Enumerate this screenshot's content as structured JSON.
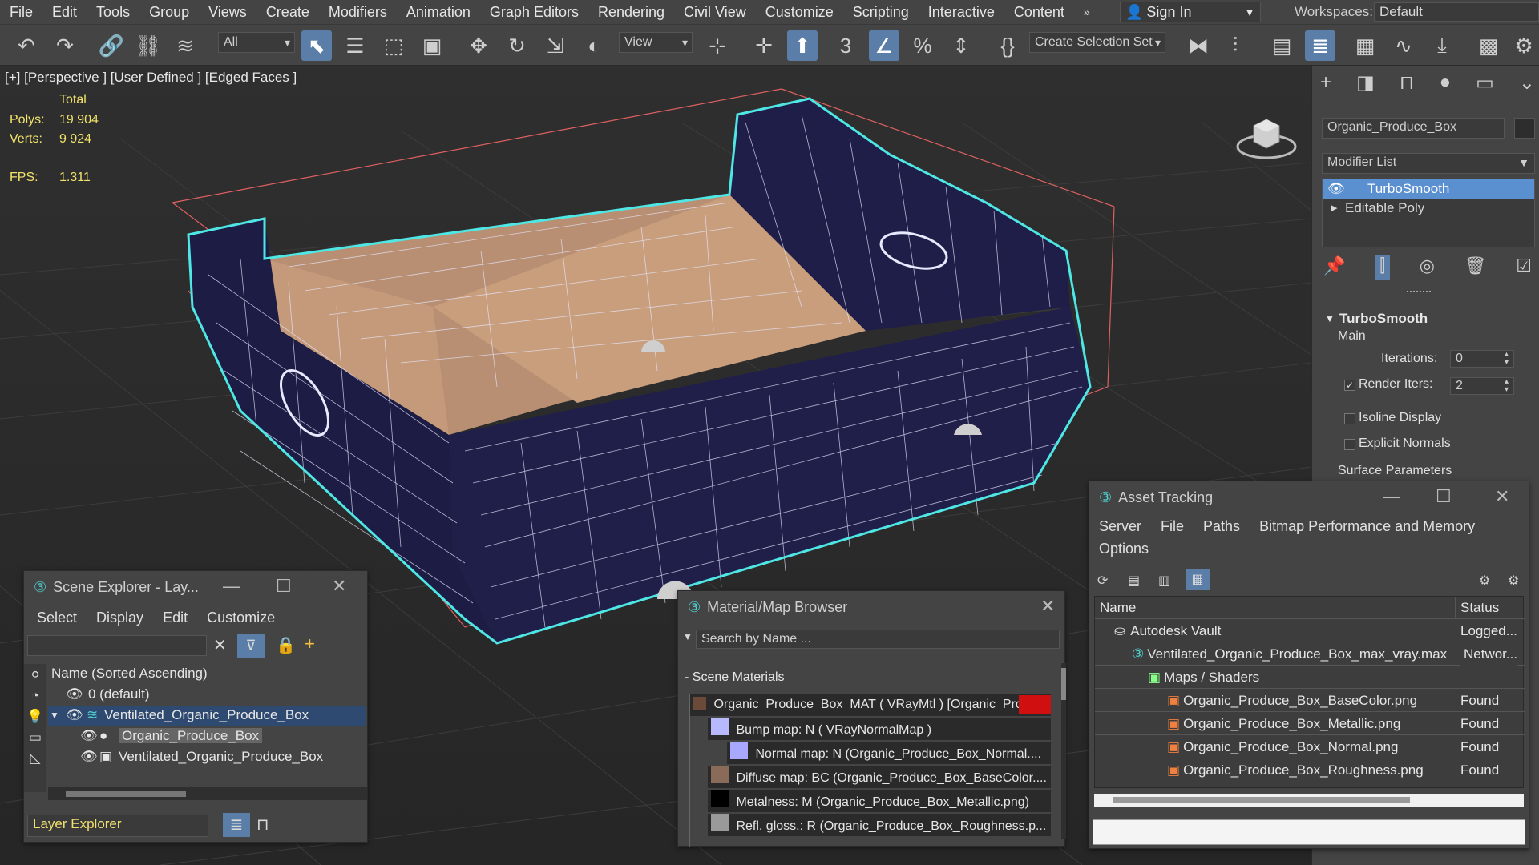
{
  "menubar": {
    "items": [
      "File",
      "Edit",
      "Tools",
      "Group",
      "Views",
      "Create",
      "Modifiers",
      "Animation",
      "Graph Editors",
      "Rendering",
      "Civil View",
      "Customize",
      "Scripting",
      "Interactive",
      "Content"
    ],
    "overflow": "»",
    "sign_in": "Sign In",
    "workspaces_label": "Workspaces:",
    "workspace_value": "Default"
  },
  "toolbar": {
    "filter_value": "All",
    "view_value": "View",
    "selection_set_value": "Create Selection Set",
    "icons": [
      "undo-icon",
      "redo-icon",
      "link-icon",
      "unlink-icon",
      "bind-spacewarp-icon",
      "select-icon",
      "select-by-name-icon",
      "rect-region-icon",
      "window-crossing-icon",
      "move-icon",
      "rotate-icon",
      "scale-icon",
      "place-icon",
      "pivot-icon",
      "snap-move-icon",
      "select-manipulate-icon",
      "snap-3d-icon",
      "angle-snap-icon",
      "percent-snap-icon",
      "spinner-snap-icon",
      "edit-named-sets-icon",
      "mirror-icon",
      "align-icon",
      "scene-explorer-icon",
      "layer-explorer-icon",
      "ribbon-icon",
      "curve-editor-icon",
      "schematic-icon",
      "material-editor-icon"
    ]
  },
  "viewport": {
    "label": "[+] [Perspective ] [User Defined ] [Edged Faces ]",
    "stats": {
      "total_label": "Total",
      "polys_label": "Polys:",
      "polys_value": "19 904",
      "verts_label": "Verts:",
      "verts_value": "9 924",
      "fps_label": "FPS:",
      "fps_value": "1.311"
    },
    "colors": {
      "wire": "#ffffff",
      "selection": "#4fe6e6",
      "crate_side": "#1e1d45",
      "crate_inner": "#c49a7a",
      "bbox": "#e06060"
    }
  },
  "command_panel": {
    "object_name": "Organic_Produce_Box",
    "modifier_list_label": "Modifier List",
    "stack": [
      {
        "name": "TurboSmooth",
        "selected": true
      },
      {
        "name": "Editable Poly",
        "selected": false
      }
    ],
    "rollout_title": "TurboSmooth",
    "group_main": "Main",
    "iterations_label": "Iterations:",
    "iterations_value": "0",
    "render_iters_label": "Render Iters:",
    "render_iters_value": "2",
    "isoline_label": "Isoline Display",
    "explicit_normals_label": "Explicit Normals",
    "surface_params_label": "Surface Parameters"
  },
  "scene_explorer": {
    "title": "Scene Explorer - Lay...",
    "menu": [
      "Select",
      "Display",
      "Edit",
      "Customize"
    ],
    "column_header": "Name (Sorted Ascending)",
    "rows": [
      {
        "name": "0 (default)",
        "indent": 0
      },
      {
        "name": "Ventilated_Organic_Produce_Box",
        "indent": 0,
        "selected": true
      },
      {
        "name": "Organic_Produce_Box",
        "indent": 1,
        "highlight": true
      },
      {
        "name": "Ventilated_Organic_Produce_Box",
        "indent": 1
      }
    ],
    "footer_label": "Layer Explorer"
  },
  "material_browser": {
    "title": "Material/Map Browser",
    "search_placeholder": "Search by Name ...",
    "section": "- Scene Materials",
    "items": [
      {
        "text": "Organic_Produce_Box_MAT  ( VRayMtl )  [Organic_Pro...",
        "swatch": "#6b4a3a"
      },
      {
        "text": "Bump map: N  ( VRayNormalMap )",
        "swatch": "#b8b8ff"
      },
      {
        "text": "Normal  map:  N  (Organic_Produce_Box_Normal....",
        "swatch": "#a8a8ff"
      },
      {
        "text": "Diffuse  map:  BC  (Organic_Produce_Box_BaseColor....",
        "swatch": "#8a6a58"
      },
      {
        "text": "Metalness: M (Organic_Produce_Box_Metallic.png)",
        "swatch": "#000000"
      },
      {
        "text": "Refl.  gloss.:  R  (Organic_Produce_Box_Roughness.p...",
        "swatch": "#9a9a9a"
      }
    ]
  },
  "asset_tracking": {
    "title": "Asset Tracking",
    "menu": [
      "Server",
      "File",
      "Paths",
      "Bitmap Performance and Memory",
      "Options"
    ],
    "col_name": "Name",
    "col_status": "Status",
    "rows": [
      {
        "name": "Autodesk Vault",
        "status": "Logged...",
        "indent": 0
      },
      {
        "name": "Ventilated_Organic_Produce_Box_max_vray.max",
        "status": "Networ...",
        "indent": 1
      },
      {
        "name": "Maps / Shaders",
        "status": "",
        "indent": 2
      },
      {
        "name": "Organic_Produce_Box_BaseColor.png",
        "status": "Found",
        "indent": 3
      },
      {
        "name": "Organic_Produce_Box_Metallic.png",
        "status": "Found",
        "indent": 3
      },
      {
        "name": "Organic_Produce_Box_Normal.png",
        "status": "Found",
        "indent": 3
      },
      {
        "name": "Organic_Produce_Box_Roughness.png",
        "status": "Found",
        "indent": 3
      }
    ]
  }
}
